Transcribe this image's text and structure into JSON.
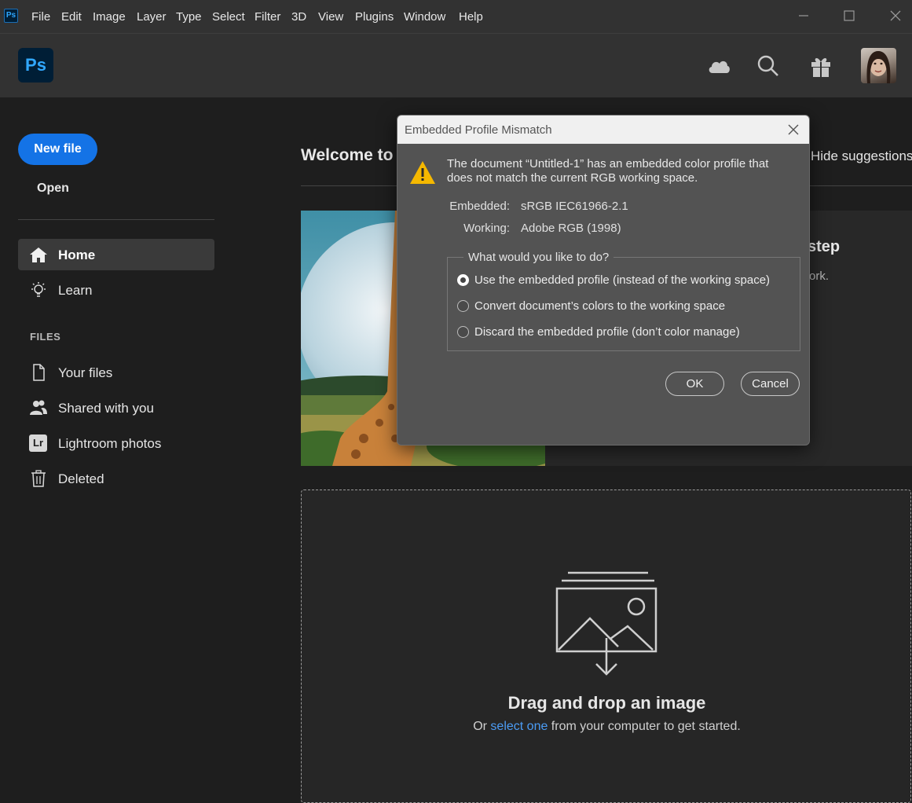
{
  "menubar": {
    "app_icon_text": "Ps",
    "items": [
      "File",
      "Edit",
      "Image",
      "Layer",
      "Type",
      "Select",
      "Filter",
      "3D",
      "View",
      "Plugins",
      "Window",
      "Help"
    ]
  },
  "header": {
    "logo_text": "Ps",
    "icons": [
      "cloud-icon",
      "search-icon",
      "gift-icon",
      "avatar"
    ]
  },
  "sidebar": {
    "new_file_label": "New file",
    "open_label": "Open",
    "nav": [
      {
        "label": "Home",
        "icon": "home-icon",
        "active": true
      },
      {
        "label": "Learn",
        "icon": "lightbulb-icon",
        "active": false
      }
    ],
    "files_header": "FILES",
    "files": [
      {
        "label": "Your files",
        "icon": "file-icon"
      },
      {
        "label": "Shared with you",
        "icon": "users-icon"
      },
      {
        "label": "Lightroom photos",
        "icon": "lightroom-icon"
      },
      {
        "label": "Deleted",
        "icon": "trash-icon"
      }
    ],
    "lightroom_badge": "Lr"
  },
  "main": {
    "welcome_title": "Welcome to P",
    "hide_suggestions_label": "Hide suggestions",
    "hero_partial_title": "step",
    "hero_partial_text": "ork.",
    "dropzone": {
      "title": "Drag and drop an image",
      "sub_prefix": "Or ",
      "sub_link": "select one",
      "sub_suffix": " from your computer to get started."
    }
  },
  "dialog": {
    "title": "Embedded Profile Mismatch",
    "message": "The document “Untitled-1” has an embedded color profile that does not match the current RGB working space.",
    "embedded_label": "Embedded:",
    "embedded_value": "sRGB IEC61966-2.1",
    "working_label": "Working:",
    "working_value": "Adobe RGB (1998)",
    "question": "What would you like to do?",
    "options": [
      {
        "label": "Use the embedded profile (instead of the working space)",
        "selected": true
      },
      {
        "label": "Convert document’s colors to the working space",
        "selected": false
      },
      {
        "label": "Discard the embedded profile (don’t color manage)",
        "selected": false
      }
    ],
    "ok_label": "OK",
    "cancel_label": "Cancel"
  },
  "colors": {
    "accent": "#1473e6",
    "ps_blue": "#31a8ff",
    "link": "#4b9cf5",
    "warning": "#f5b800"
  }
}
